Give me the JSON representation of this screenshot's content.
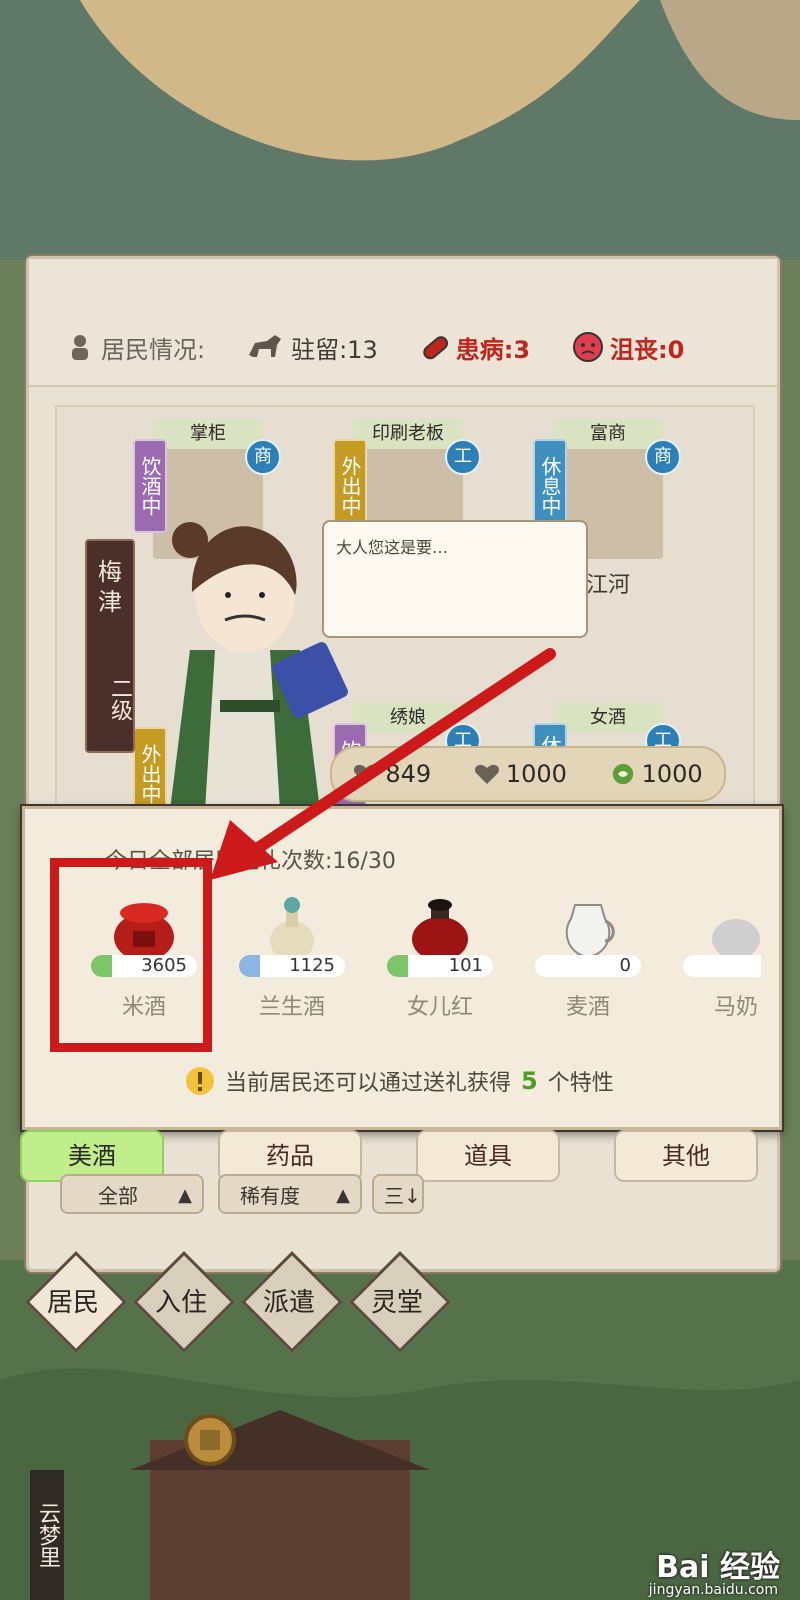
{
  "status": {
    "label": "居民情况:",
    "stay": "驻留:13",
    "sick": "患病:3",
    "depressed": "沮丧:0"
  },
  "residents": [
    {
      "title": "掌柜",
      "tag": "饮酒中",
      "badge": "商",
      "name": "",
      "tag_color": "#9b6bb0"
    },
    {
      "title": "印刷老板",
      "tag": "外出中",
      "badge": "工",
      "name": "",
      "tag_color": "#c59b22"
    },
    {
      "title": "富商",
      "tag": "休息中",
      "badge": "商",
      "name": "江河",
      "tag_color": "#3f8fbf"
    },
    {
      "title": "",
      "tag": "外出中",
      "badge": "",
      "name": "",
      "tag_color": "#c59b22"
    },
    {
      "title": "绣娘",
      "tag": "饮酒中",
      "badge": "工",
      "name": "",
      "tag_color": "#9b6bb0"
    },
    {
      "title": "女酒",
      "tag": "休",
      "badge": "工",
      "name": "",
      "tag_color": "#3f8fbf"
    }
  ],
  "selected_resident": {
    "name": "梅津",
    "level": "二级"
  },
  "speech": "大人您这是要…",
  "stats": {
    "a": "849",
    "b": "1000",
    "c": "1000"
  },
  "gift": {
    "header": "今日全部居民送礼次数:16/30",
    "items": [
      {
        "name": "米酒",
        "count": "3605",
        "color": "#c0221c",
        "fill": 0.2
      },
      {
        "name": "兰生酒",
        "count": "1125",
        "color": "#e8e0c0",
        "fill": 0.2
      },
      {
        "name": "女儿红",
        "count": "101",
        "color": "#9c1414",
        "fill": 0.2
      },
      {
        "name": "麦酒",
        "count": "0",
        "color": "#f2f2f2",
        "fill": 0.0
      },
      {
        "name": "马奶",
        "count": "",
        "color": "#cfcfcf",
        "fill": 0.0
      }
    ],
    "note_prefix": "当前居民还可以通过送礼获得",
    "note_number": "5",
    "note_suffix": "个特性"
  },
  "tabs": [
    "美酒",
    "药品",
    "道具",
    "其他"
  ],
  "filters": {
    "all": "全部",
    "rarity": "稀有度",
    "sort": "三↓"
  },
  "nav": [
    "居民",
    "入住",
    "派遣",
    "灵堂"
  ],
  "village": "云梦里",
  "watermark": {
    "main": "Bai 经验",
    "sub": "jingyan.baidu.com"
  }
}
